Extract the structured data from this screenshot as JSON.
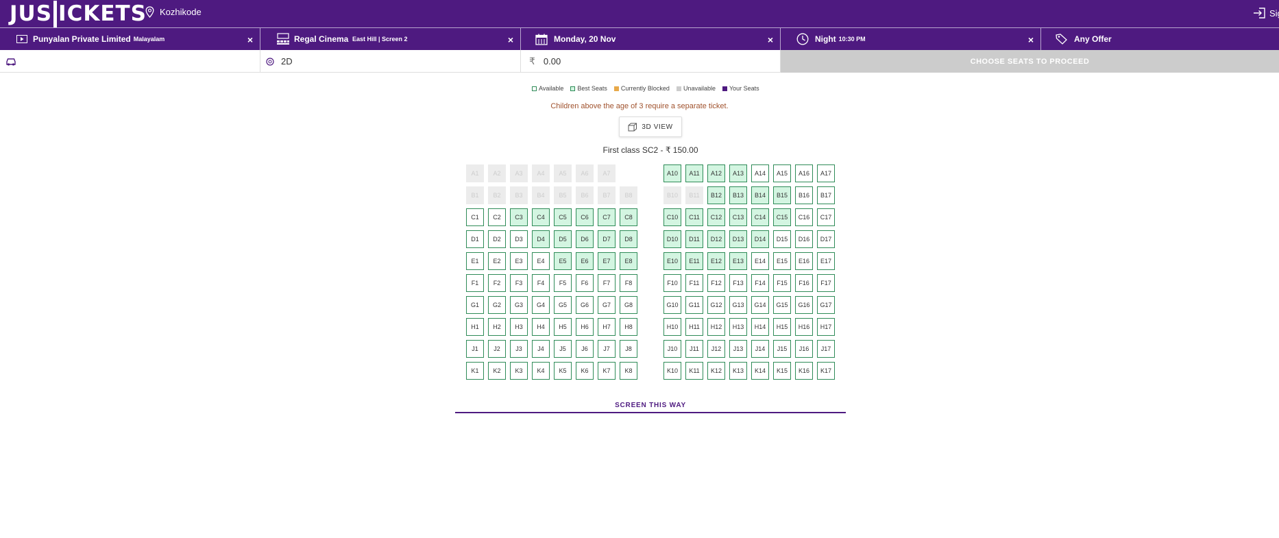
{
  "header": {
    "logo": "JUSTICKETS",
    "logo_left": "JUS",
    "logo_right": "ICKETS",
    "location": "Kozhikode",
    "signin": "Sign In"
  },
  "filters": [
    {
      "label": "Punyalan Private Limited",
      "sub": "Malayalam",
      "icon": "play-icon"
    },
    {
      "label": "Regal Cinema",
      "sub": "East Hill | Screen 2",
      "icon": "cinema-icon"
    },
    {
      "label": "Monday, 20 Nov",
      "sub": "",
      "icon": "calendar-icon"
    },
    {
      "label": "Night",
      "sub": "10:30 PM",
      "icon": "clock-icon"
    },
    {
      "label": "Any Offer",
      "sub": "",
      "icon": "offer-tag-icon"
    }
  ],
  "info": {
    "format": "2D",
    "currency": "₹",
    "amount": "0.00",
    "proceed_label": "CHOOSE SEATS TO PROCEED"
  },
  "legend": [
    {
      "label": "Available",
      "type": "available"
    },
    {
      "label": "Best Seats",
      "type": "best"
    },
    {
      "label": "Currently Blocked",
      "type": "blocked"
    },
    {
      "label": "Unavailable",
      "type": "unavailable"
    },
    {
      "label": "Your Seats",
      "type": "yours"
    }
  ],
  "notice": "Children above the age of 3 require a separate ticket.",
  "view3d_label": "3D VIEW",
  "class_label": "First class SC2 - ₹ 150.00",
  "screen_label": "SCREEN THIS WAY",
  "colors": {
    "brand": "#4e1a80",
    "best_seat": "#d3f5e1",
    "seat_border": "#2e8b57",
    "blocked": "#e8a94a",
    "unavailable": "#ececec"
  },
  "seat_rows": [
    {
      "row": "A",
      "unavailable": [
        1,
        2,
        3,
        4,
        5,
        6,
        7
      ],
      "best": [
        10,
        11,
        12,
        13
      ],
      "missing": [
        8
      ]
    },
    {
      "row": "B",
      "unavailable": [
        1,
        2,
        3,
        4,
        5,
        6,
        7,
        8,
        10,
        11
      ],
      "best": [
        12,
        13,
        14,
        15
      ],
      "missing": []
    },
    {
      "row": "C",
      "unavailable": [],
      "best": [
        3,
        4,
        5,
        6,
        7,
        8,
        10,
        11,
        12,
        13,
        14,
        15
      ],
      "missing": []
    },
    {
      "row": "D",
      "unavailable": [],
      "best": [
        4,
        5,
        6,
        7,
        8,
        10,
        11,
        12,
        13,
        14
      ],
      "missing": []
    },
    {
      "row": "E",
      "unavailable": [],
      "best": [
        5,
        6,
        7,
        8,
        10,
        11,
        12,
        13
      ],
      "missing": []
    },
    {
      "row": "F",
      "unavailable": [],
      "best": [],
      "missing": []
    },
    {
      "row": "G",
      "unavailable": [],
      "best": [],
      "missing": []
    },
    {
      "row": "H",
      "unavailable": [],
      "best": [],
      "missing": []
    },
    {
      "row": "J",
      "unavailable": [],
      "best": [],
      "missing": []
    },
    {
      "row": "K",
      "unavailable": [],
      "best": [],
      "missing": []
    }
  ]
}
